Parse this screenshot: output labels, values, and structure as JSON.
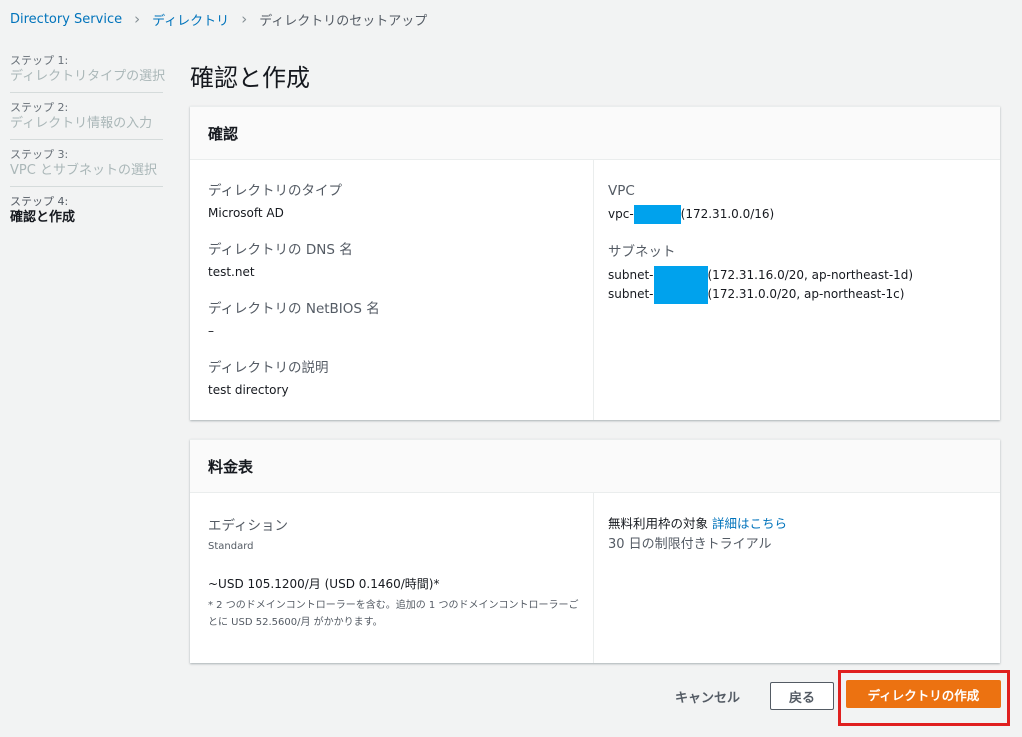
{
  "breadcrumb": {
    "items": [
      "Directory Service",
      "ディレクトリ"
    ],
    "current": "ディレクトリのセットアップ"
  },
  "steps": [
    {
      "num": "ステップ 1:",
      "name": "ディレクトリタイプの選択"
    },
    {
      "num": "ステップ 2:",
      "name": "ディレクトリ情報の入力"
    },
    {
      "num": "ステップ 3:",
      "name": "VPC とサブネットの選択"
    },
    {
      "num": "ステップ 4:",
      "name": "確認と作成"
    }
  ],
  "page_title": "確認と作成",
  "review": {
    "title": "確認",
    "directory_type_label": "ディレクトリのタイプ",
    "directory_type_value": "Microsoft AD",
    "dns_label": "ディレクトリの DNS 名",
    "dns_value": "test.net",
    "netbios_label": "ディレクトリの NetBIOS 名",
    "netbios_value": "–",
    "desc_label": "ディレクトリの説明",
    "desc_value": "test directory",
    "vpc_label": "VPC",
    "vpc_prefix": "vpc-",
    "vpc_cidr": "(172.31.0.0/16)",
    "subnet_label": "サブネット",
    "subnets": [
      {
        "prefix": "subnet-",
        "detail": "(172.31.16.0/20, ap-northeast-1d)"
      },
      {
        "prefix": "subnet-",
        "detail": "(172.31.0.0/20, ap-northeast-1c)"
      }
    ]
  },
  "pricing": {
    "title": "料金表",
    "edition_label": "エディション",
    "edition_value": "Standard",
    "price": "~USD 105.1200/月 (USD 0.1460/時間)*",
    "note": "* 2 つのドメインコントローラーを含む。追加の 1 つのドメインコントローラーごとに USD 52.5600/月 がかかります。",
    "free_tier_label": "無料利用枠の対象",
    "free_tier_link": "詳細はこちら",
    "trial": "30 日の制限付きトライアル"
  },
  "actions": {
    "cancel": "キャンセル",
    "back": "戻る",
    "create": "ディレクトリの作成"
  },
  "colors": {
    "primary": "#ec7211",
    "link": "#0073bb",
    "highlight": "#e0201f",
    "masked": "#00a2ed"
  }
}
